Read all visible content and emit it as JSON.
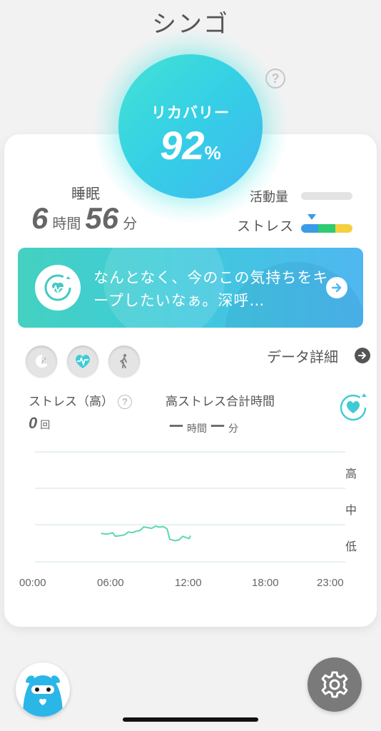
{
  "header": {
    "title": "シンゴ"
  },
  "recovery": {
    "label": "リカバリー",
    "value": "92",
    "unit": "%"
  },
  "sleep": {
    "label": "睡眠",
    "hours": "6",
    "hours_unit": "時間",
    "minutes": "56",
    "minutes_unit": "分"
  },
  "activity": {
    "label": "活動量",
    "level": 0
  },
  "stress_meter": {
    "label": "ストレス",
    "colors": [
      "#3a9be8",
      "#2ecc71",
      "#f4d03f"
    ]
  },
  "message": {
    "text": "なんとなく、今のこの気持ちをキープしたいなぁ。深呼…"
  },
  "tabs": [
    {
      "icon": "moon-sleep-icon"
    },
    {
      "icon": "heart-pulse-icon"
    },
    {
      "icon": "walking-icon"
    }
  ],
  "data_detail": {
    "label": "データ詳細"
  },
  "stats": {
    "high_stress_label": "ストレス（高）",
    "high_stress_count": "0",
    "high_stress_count_unit": "回",
    "total_time_label": "高ストレス合計時間",
    "total_hours": "ー",
    "total_hours_unit": "時間",
    "total_minutes": "ー",
    "total_minutes_unit": "分"
  },
  "chart_data": {
    "type": "line",
    "y_levels": [
      "高",
      "中",
      "低"
    ],
    "x_ticks": [
      "00:00",
      "06:00",
      "12:00",
      "18:00",
      "23:00"
    ],
    "x_range_hours": [
      0,
      23
    ],
    "y_range": [
      0,
      3
    ],
    "series": [
      {
        "color": "#5cd6b4",
        "points": [
          [
            5.1,
            0.78
          ],
          [
            5.6,
            0.76
          ],
          [
            6.0,
            0.8
          ],
          [
            6.2,
            0.7
          ],
          [
            6.6,
            0.72
          ],
          [
            6.9,
            0.74
          ],
          [
            7.2,
            0.82
          ],
          [
            7.5,
            0.8
          ],
          [
            7.8,
            0.84
          ],
          [
            8.1,
            0.86
          ],
          [
            8.4,
            0.96
          ],
          [
            8.7,
            0.94
          ],
          [
            9.0,
            0.92
          ],
          [
            9.3,
            0.98
          ],
          [
            9.6,
            0.95
          ],
          [
            9.9,
            0.97
          ],
          [
            10.2,
            0.9
          ],
          [
            10.4,
            0.62
          ],
          [
            10.8,
            0.58
          ],
          [
            11.1,
            0.6
          ],
          [
            11.4,
            0.7
          ],
          [
            11.7,
            0.66
          ],
          [
            11.9,
            0.64
          ],
          [
            12.0,
            0.72
          ]
        ]
      }
    ]
  }
}
